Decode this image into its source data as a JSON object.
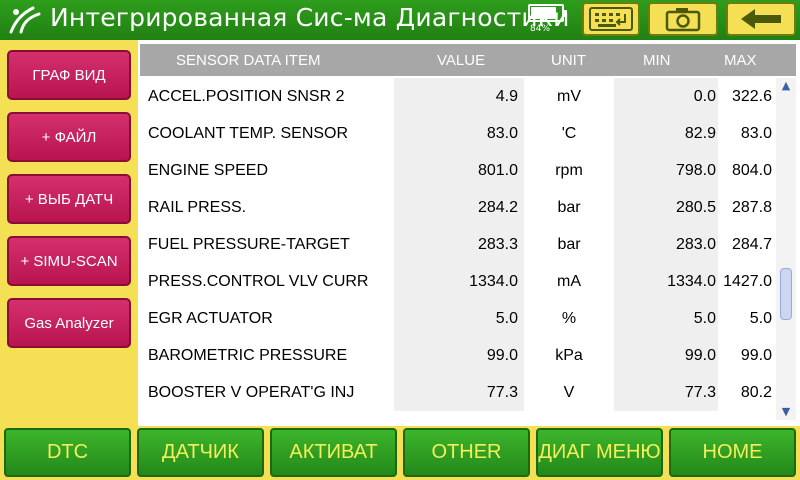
{
  "header": {
    "title": "Интегрированная Сис-ма Диагностики",
    "battery_percent": 84,
    "battery_label": "84%",
    "icons": [
      "logo-icon",
      "battery-icon",
      "keyboard-icon",
      "camera-icon",
      "back-arrow-icon"
    ]
  },
  "sidebar": {
    "buttons": [
      {
        "label": "ГРАФ ВИД"
      },
      {
        "label": "+ ФАЙЛ"
      },
      {
        "label": "+ ВЫБ ДАТЧ"
      },
      {
        "label": "+ SIMU-SCAN"
      },
      {
        "label": "Gas Analyzer"
      }
    ]
  },
  "table": {
    "columns": {
      "item": "SENSOR DATA ITEM",
      "value": "VALUE",
      "unit": "UNIT",
      "min": "MIN",
      "max": "MAX"
    },
    "rows": [
      {
        "item": "ACCEL.POSITION SNSR 2",
        "value": "4.9",
        "unit": "mV",
        "min": "0.0",
        "max": "322.6"
      },
      {
        "item": "COOLANT TEMP. SENSOR",
        "value": "83.0",
        "unit": "'C",
        "min": "82.9",
        "max": "83.0"
      },
      {
        "item": "ENGINE SPEED",
        "value": "801.0",
        "unit": "rpm",
        "min": "798.0",
        "max": "804.0"
      },
      {
        "item": "RAIL PRESS.",
        "value": "284.2",
        "unit": "bar",
        "min": "280.5",
        "max": "287.8"
      },
      {
        "item": "FUEL PRESSURE-TARGET",
        "value": "283.3",
        "unit": "bar",
        "min": "283.0",
        "max": "284.7"
      },
      {
        "item": "PRESS.CONTROL VLV CURR",
        "value": "1334.0",
        "unit": "mA",
        "min": "1334.0",
        "max": "1427.0"
      },
      {
        "item": "EGR ACTUATOR",
        "value": "5.0",
        "unit": "%",
        "min": "5.0",
        "max": "5.0"
      },
      {
        "item": "BAROMETRIC PRESSURE",
        "value": "99.0",
        "unit": "kPa",
        "min": "99.0",
        "max": "99.0"
      },
      {
        "item": "BOOSTER V OPERAT'G INJ",
        "value": "77.3",
        "unit": "V",
        "min": "77.3",
        "max": "80.2"
      }
    ]
  },
  "bottom": {
    "buttons": [
      {
        "label": "DTC"
      },
      {
        "label": "ДАТЧИК"
      },
      {
        "label": "АКТИВАТ"
      },
      {
        "label": "OTHER"
      },
      {
        "label": "ДИАГ МЕНЮ"
      },
      {
        "label": "HOME"
      }
    ]
  },
  "colors": {
    "header_green": "#2e9d1c",
    "background_yellow": "#f5df55",
    "sidebar_magenta": "#c41f5c",
    "bottom_green": "#3db42c",
    "bottom_text_yellow": "#f5ef5a",
    "table_header_gray": "#a7a7a7"
  }
}
